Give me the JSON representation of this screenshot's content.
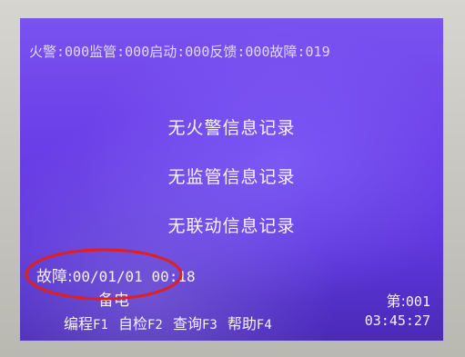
{
  "status_bar": {
    "fire_label": "火警:",
    "fire_count": "000",
    "supervise_label": "监管:",
    "supervise_count": "000",
    "start_label": "启动:",
    "start_count": "000",
    "feedback_label": "反馈:",
    "feedback_count": "000",
    "fault_label": "故障:",
    "fault_count": "019"
  },
  "records": [
    "无火警信息记录",
    "无监管信息记录",
    "无联动信息记录"
  ],
  "fault_entry": {
    "label": "故障:",
    "date": "00/01/01",
    "time": "00:18",
    "description": "备电"
  },
  "page": {
    "label": "第:",
    "number": "001"
  },
  "function_keys": [
    {
      "label": "编程",
      "key": "F1"
    },
    {
      "label": "自检",
      "key": "F2"
    },
    {
      "label": "查询",
      "key": "F3"
    },
    {
      "label": "帮助",
      "key": "F4"
    }
  ],
  "clock": "03:45:27",
  "colors": {
    "screen": "#6a3ee8",
    "text": "#f4f1ff",
    "annotation_circle": "#e02020"
  }
}
